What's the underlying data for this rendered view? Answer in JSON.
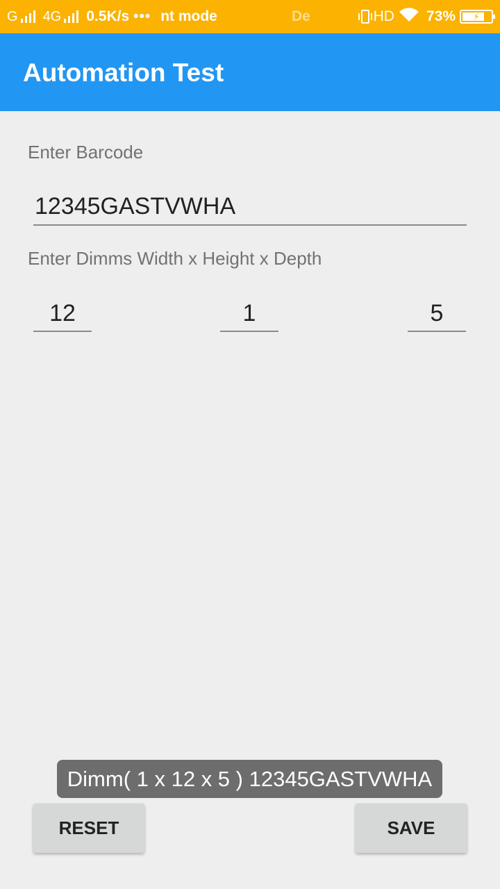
{
  "status_bar": {
    "carrier1": "G",
    "carrier2": "4G",
    "speed": "0.5K/s",
    "dots": "•••",
    "notification_partial": "nt mode",
    "notification_faded": "De",
    "hd": "HD",
    "battery": "73%"
  },
  "app_bar": {
    "title": "Automation Test"
  },
  "form": {
    "barcode_label": "Enter Barcode",
    "barcode_value": "12345GASTVWHA",
    "dims_label": "Enter Dimms Width x Height x Depth",
    "width_value": "12",
    "height_value": "1",
    "depth_value": "5"
  },
  "toast": {
    "message": "Dimm( 1 x 12 x 5 ) 12345GASTVWHA"
  },
  "buttons": {
    "reset": "RESET",
    "save": "SAVE"
  },
  "colors": {
    "status_bar": "#fbb200",
    "app_bar": "#2196f3",
    "background": "#eeeeee",
    "button": "#d6d7d7",
    "toast": "#6d6d6d"
  }
}
